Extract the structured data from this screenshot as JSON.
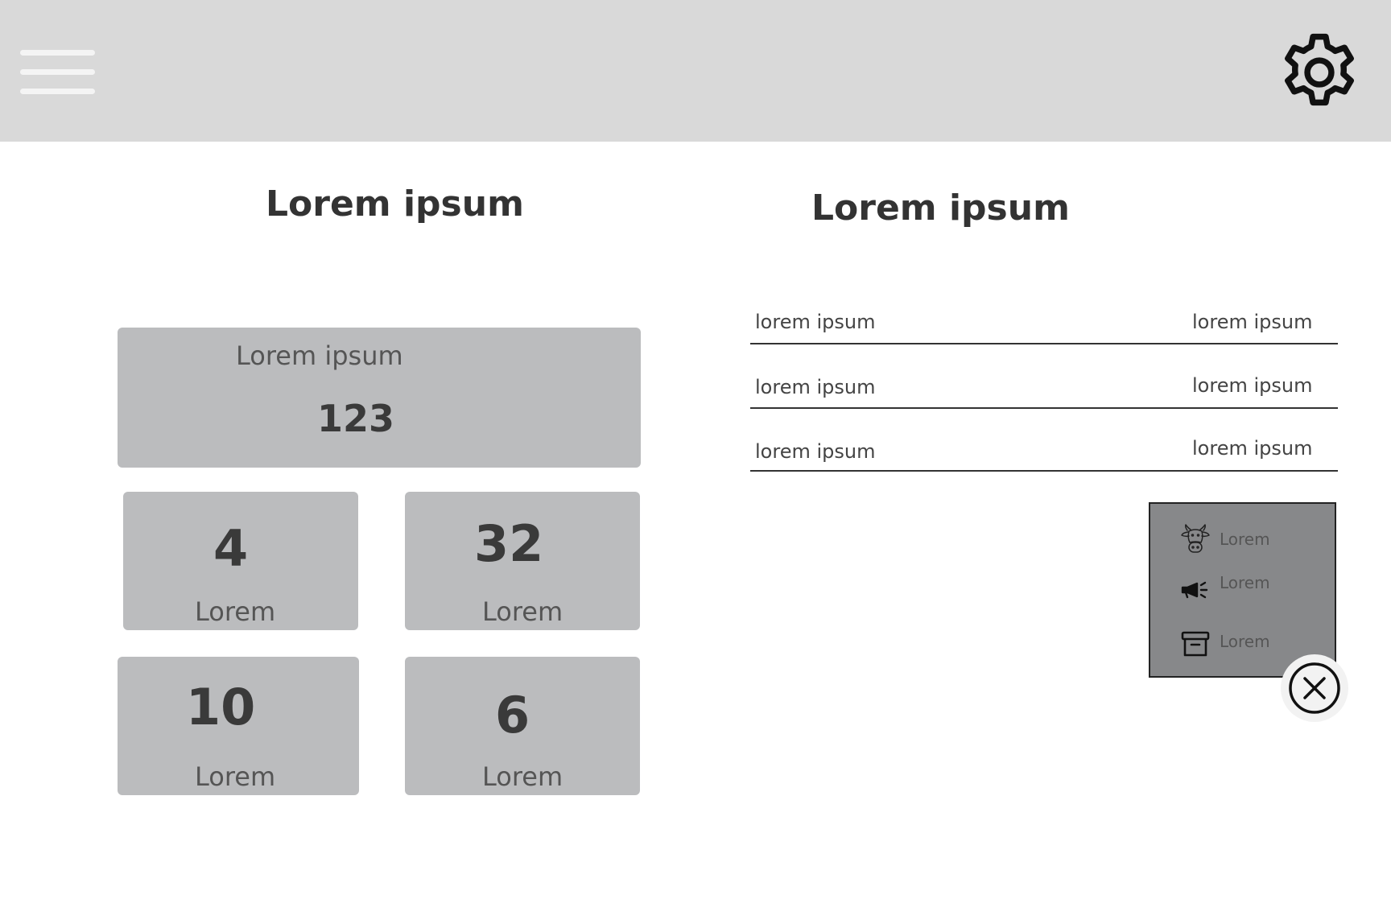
{
  "header": {
    "menu_icon": "hamburger-menu-icon",
    "settings_icon": "gear-icon"
  },
  "left_panel": {
    "title": "Lorem ipsum",
    "summary_card": {
      "label": "Lorem ipsum",
      "value": "123"
    },
    "stat_cards": [
      {
        "value": "4",
        "label": "Lorem"
      },
      {
        "value": "32",
        "label": "Lorem"
      },
      {
        "value": "10",
        "label": "Lorem"
      },
      {
        "value": "6",
        "label": "Lorem"
      }
    ]
  },
  "right_panel": {
    "title": "Lorem ipsum",
    "rows": [
      {
        "key": "lorem ipsum",
        "value": "lorem ipsum"
      },
      {
        "key": "lorem ipsum",
        "value": "lorem ipsum"
      },
      {
        "key": "lorem ipsum",
        "value": "lorem ipsum"
      }
    ],
    "popup_menu": {
      "items": [
        {
          "icon": "cow-icon",
          "label": "Lorem"
        },
        {
          "icon": "megaphone-icon",
          "label": "Lorem"
        },
        {
          "icon": "archive-box-icon",
          "label": "Lorem"
        }
      ],
      "close_icon": "close-circle-icon"
    }
  },
  "colors": {
    "header_bg": "#d9d9d9",
    "card_bg": "#bbbcbe",
    "popup_bg": "#87888a",
    "text_dark": "#333333"
  }
}
